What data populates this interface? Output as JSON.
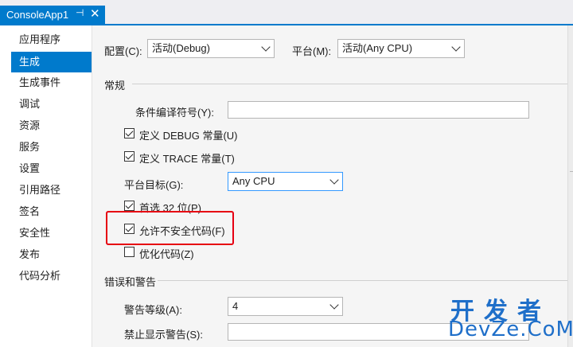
{
  "tab": {
    "title": "ConsoleApp1",
    "pin_glyph": "⊣",
    "close_glyph": "✕"
  },
  "sidebar": {
    "items": [
      {
        "label": "应用程序",
        "active": false
      },
      {
        "label": "生成",
        "active": true
      },
      {
        "label": "生成事件",
        "active": false
      },
      {
        "label": "调试",
        "active": false
      },
      {
        "label": "资源",
        "active": false
      },
      {
        "label": "服务",
        "active": false
      },
      {
        "label": "设置",
        "active": false
      },
      {
        "label": "引用路径",
        "active": false
      },
      {
        "label": "签名",
        "active": false
      },
      {
        "label": "安全性",
        "active": false
      },
      {
        "label": "发布",
        "active": false
      },
      {
        "label": "代码分析",
        "active": false
      }
    ]
  },
  "toolbar": {
    "config_label": "配置(C):",
    "config_value": "活动(Debug)",
    "platform_label": "平台(M):",
    "platform_value": "活动(Any CPU)"
  },
  "general": {
    "title": "常规",
    "symbols_label": "条件编译符号(Y):",
    "symbols_value": "",
    "define_debug": {
      "label": "定义 DEBUG 常量(U)",
      "checked": true
    },
    "define_trace": {
      "label": "定义 TRACE 常量(T)",
      "checked": true
    },
    "platform_target_label": "平台目标(G):",
    "platform_target_value": "Any CPU",
    "prefer32": {
      "label": "首选 32 位(P)",
      "checked": true
    },
    "allow_unsafe": {
      "label": "允许不安全代码(F)",
      "checked": true
    },
    "optimize": {
      "label": "优化代码(Z)",
      "checked": false
    }
  },
  "errors": {
    "title": "错误和警告",
    "warning_level_label": "警告等级(A):",
    "warning_level_value": "4",
    "suppress_label": "禁止显示警告(S):",
    "suppress_value": ""
  },
  "watermark": {
    "line1": "开发者",
    "line2": "DevZe.CoM"
  },
  "colors": {
    "accent": "#007acc",
    "highlight": "#e60012",
    "watermark": "#1f6fc9"
  }
}
